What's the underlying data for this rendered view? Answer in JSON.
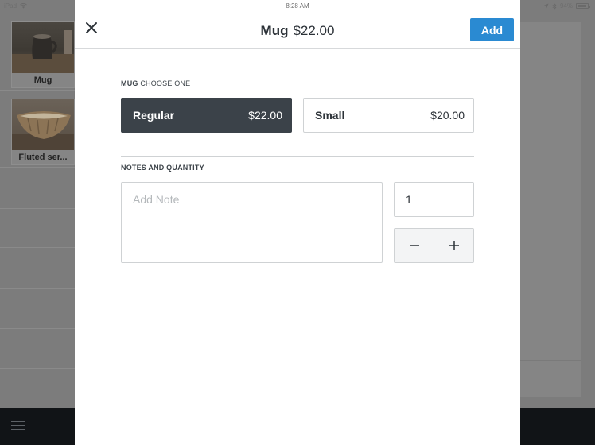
{
  "status_bar": {
    "device": "iPad",
    "time": "8:28 AM",
    "battery": "94%"
  },
  "items": [
    {
      "label": "Mug"
    },
    {
      "label": "Fluted ser..."
    }
  ],
  "modal": {
    "title": "Mug",
    "price": "$22.00",
    "add_label": "Add",
    "variant_section": {
      "item_name": "MUG",
      "label": "CHOOSE ONE"
    },
    "variants": [
      {
        "name": "Regular",
        "price": "$22.00",
        "selected": true
      },
      {
        "name": "Small",
        "price": "$20.00",
        "selected": false
      }
    ],
    "notes_section": {
      "label": "NOTES AND QUANTITY"
    },
    "note": {
      "placeholder": "Add Note",
      "value": ""
    },
    "quantity": {
      "value": "1"
    }
  },
  "colors": {
    "accent": "#2a8ad2",
    "selected_variant": "#3b4249",
    "bottom_bar": "#111417"
  }
}
